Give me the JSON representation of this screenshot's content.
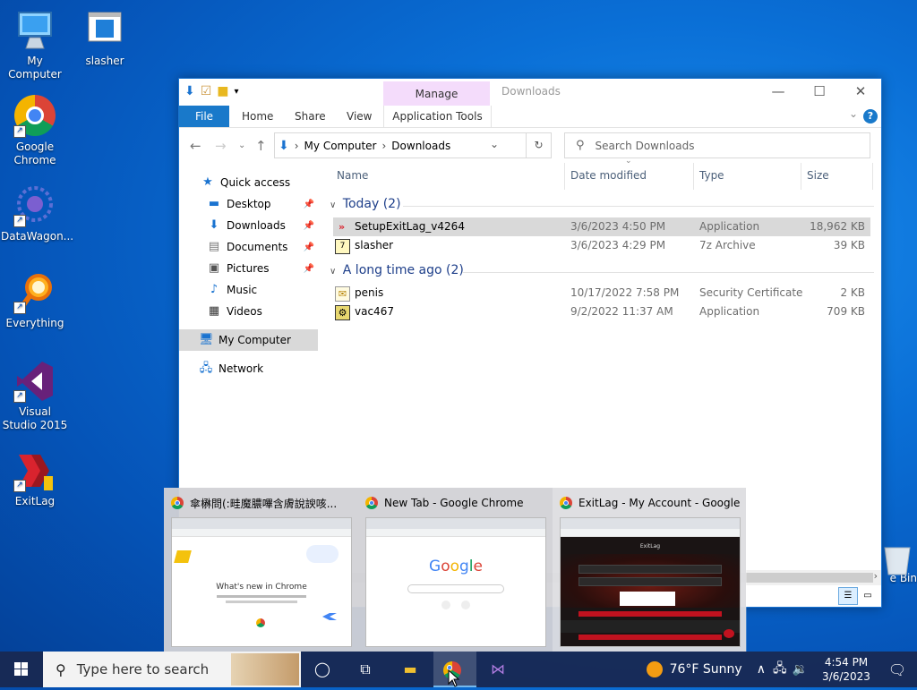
{
  "desktop": {
    "icons": [
      {
        "label": "My Computer"
      },
      {
        "label": "slasher"
      },
      {
        "label": "Google Chrome"
      },
      {
        "label": "DataWagon..."
      },
      {
        "label": "Everything"
      },
      {
        "label": "Visual Studio 2015"
      },
      {
        "label": "ExitLag"
      },
      {
        "label": "e Bin"
      }
    ]
  },
  "window": {
    "title": "Downloads",
    "manage_tab": "Manage",
    "ribbon": {
      "file": "File",
      "home": "Home",
      "share": "Share",
      "view": "View",
      "app_tools": "Application Tools"
    },
    "address": {
      "crumbs": [
        "My Computer",
        "Downloads"
      ]
    },
    "search_placeholder": "Search Downloads",
    "nav": [
      {
        "label": "Quick access"
      },
      {
        "label": "Desktop"
      },
      {
        "label": "Downloads"
      },
      {
        "label": "Documents"
      },
      {
        "label": "Pictures"
      },
      {
        "label": "Music"
      },
      {
        "label": "Videos"
      },
      {
        "label": "My Computer"
      },
      {
        "label": "Network"
      }
    ],
    "columns": {
      "name": "Name",
      "date": "Date modified",
      "type": "Type",
      "size": "Size"
    },
    "groups": [
      {
        "label": "Today (2)",
        "files": [
          {
            "name": "SetupExitLag_v4264",
            "date": "3/6/2023 4:50 PM",
            "type": "Application",
            "size": "18,962 KB"
          },
          {
            "name": "slasher",
            "date": "3/6/2023 4:29 PM",
            "type": "7z Archive",
            "size": "39 KB"
          }
        ]
      },
      {
        "label": "A long time ago (2)",
        "files": [
          {
            "name": "penis",
            "date": "10/17/2022 7:58 PM",
            "type": "Security Certificate",
            "size": "2 KB"
          },
          {
            "name": "vac467",
            "date": "9/2/2022 11:37 AM",
            "type": "Application",
            "size": "709 KB"
          }
        ]
      }
    ]
  },
  "thumbnails": [
    {
      "title": "傘楙問(:畦魔膿嗶含膚說諛咳...",
      "preview_text": "What's new in Chrome"
    },
    {
      "title": "New Tab - Google Chrome",
      "preview_text": "Google"
    },
    {
      "title": "ExitLag - My Account - Google ...",
      "preview_text": "ExitLag"
    }
  ],
  "taskbar": {
    "search_placeholder": "Type here to search",
    "weather": "76°F  Sunny",
    "time": "4:54 PM",
    "date": "3/6/2023"
  },
  "colors": {
    "accent": "#1979ca",
    "desktop": "#0a6fd6",
    "taskbar": "#1a2850"
  }
}
